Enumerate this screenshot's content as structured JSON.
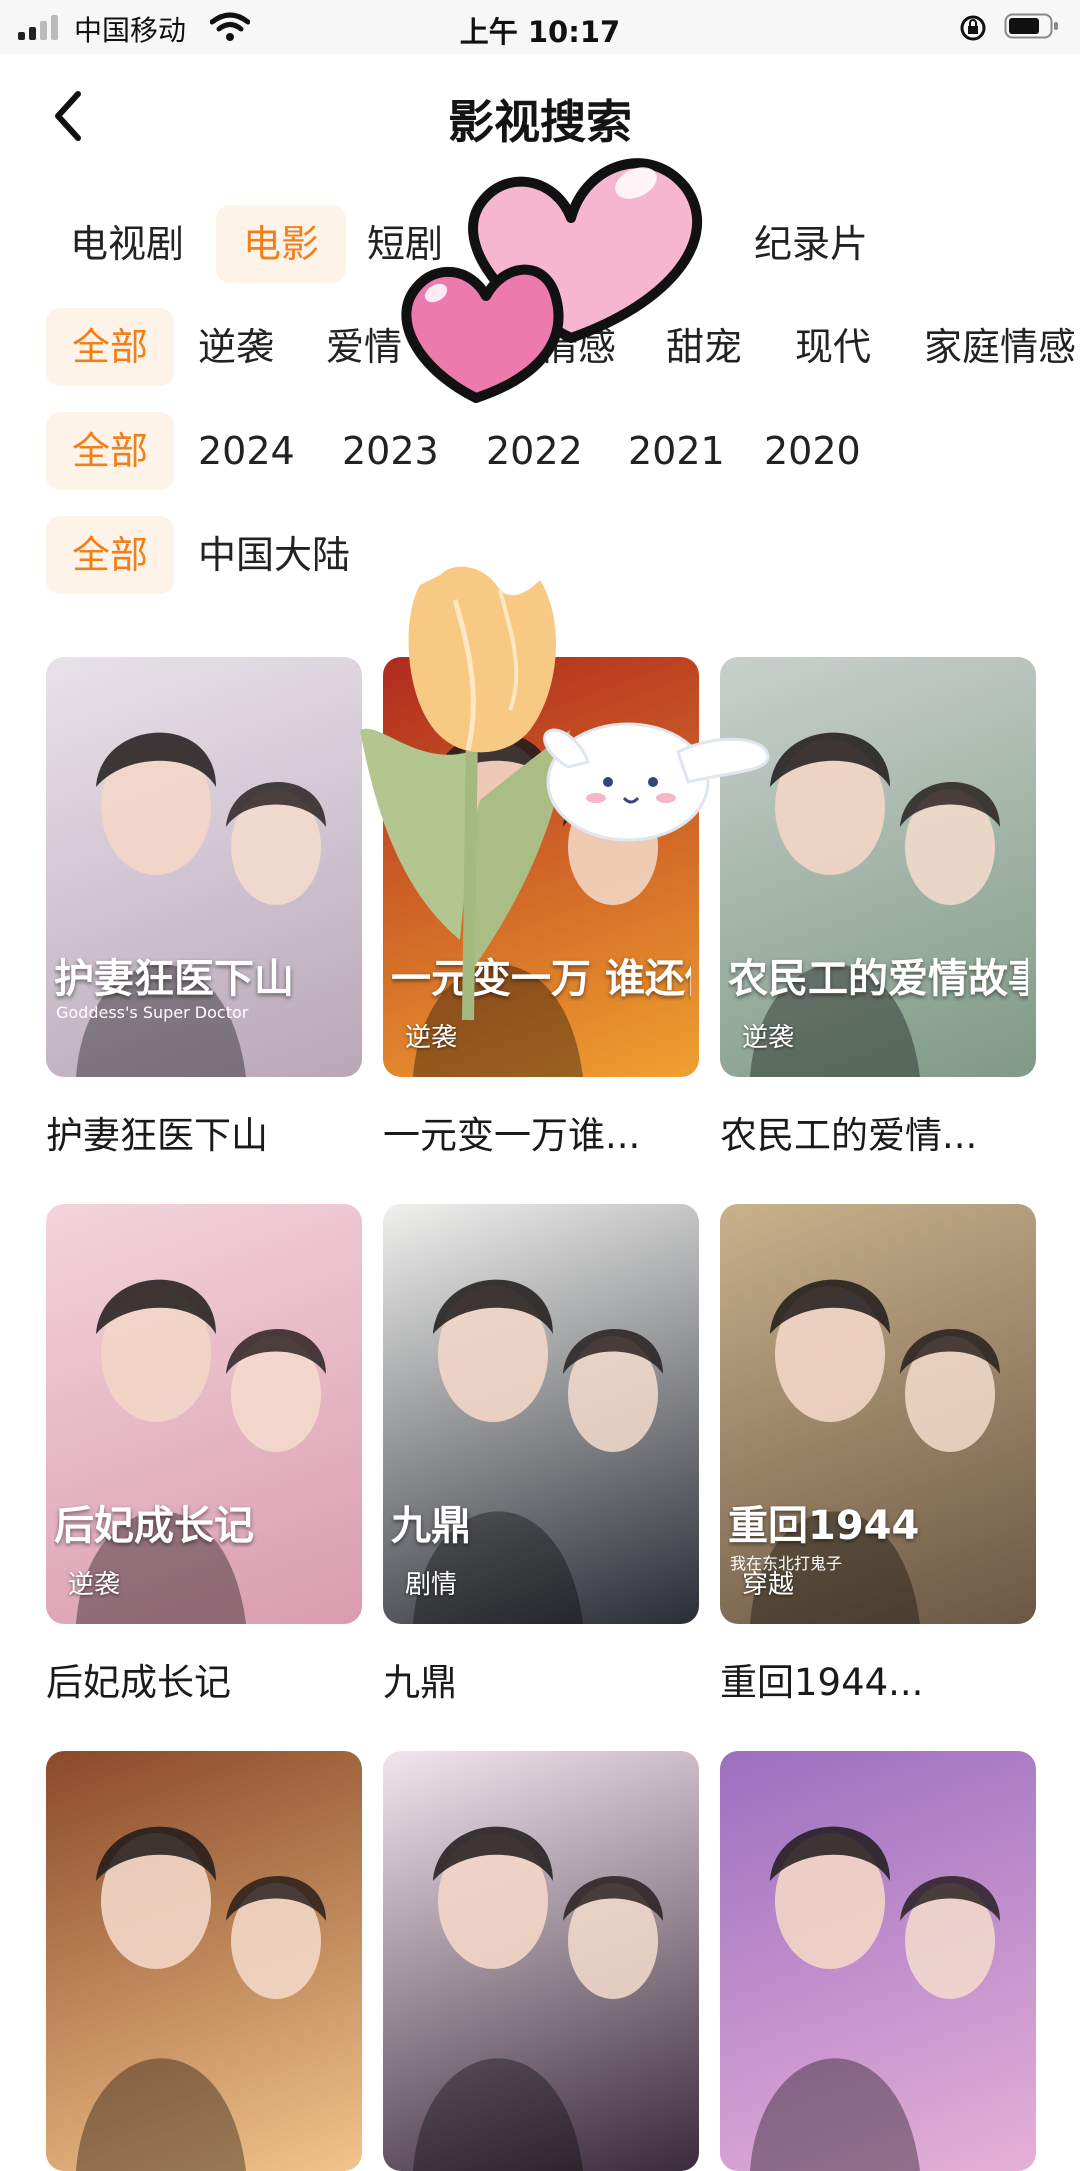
{
  "status_bar": {
    "carrier": "中国移动",
    "time": "上午 10:17"
  },
  "header": {
    "title": "影视搜索"
  },
  "filters": {
    "type": {
      "items": [
        "电视剧",
        "电影",
        "短剧",
        "",
        "纪录片"
      ],
      "selected": "电影"
    },
    "genre": {
      "all_label": "全部",
      "items": [
        "逆袭",
        "爱情",
        "情感",
        "甜宠",
        "现代",
        "家庭情感"
      ]
    },
    "year": {
      "all_label": "全部",
      "items": [
        "2024",
        "2023",
        "2022",
        "2021",
        "2020"
      ]
    },
    "region": {
      "all_label": "全部",
      "items": [
        "中国大陆"
      ]
    }
  },
  "results": [
    {
      "title": "护妻狂医下山",
      "tag": "",
      "poster_text": "护妻狂医下山",
      "poster_subtext": "Goddess's Super Doctor",
      "colors": [
        "#e8e2ea",
        "#b9a7b7"
      ]
    },
    {
      "title": "一元变一万谁...",
      "tag": "逆袭",
      "poster_text": "一元变一万 谁还做舔狗",
      "colors": [
        "#b02a1e",
        "#f0a030"
      ]
    },
    {
      "title": "农民工的爱情...",
      "tag": "逆袭",
      "poster_text": "农民工的爱情故事",
      "colors": [
        "#c9d0cc",
        "#7f9a86"
      ]
    },
    {
      "title": "后妃成长记",
      "tag": "逆袭",
      "poster_text": "后妃成长记",
      "colors": [
        "#f3d3dc",
        "#d99cae"
      ]
    },
    {
      "title": "九鼎",
      "tag": "剧情",
      "poster_text": "九鼎",
      "colors": [
        "#f0f0ee",
        "#2a2d35"
      ]
    },
    {
      "title": "重回1944...",
      "tag": "穿越",
      "poster_text": "重回1944",
      "poster_subtext": "我在东北打鬼子",
      "colors": [
        "#c9b18c",
        "#6b5744"
      ]
    },
    {
      "title": "",
      "tag": "",
      "poster_text": "",
      "colors": [
        "#8a4a2a",
        "#f2c48a"
      ]
    },
    {
      "title": "",
      "tag": "",
      "poster_text": "",
      "colors": [
        "#f2e6ee",
        "#3b2a3a"
      ]
    },
    {
      "title": "",
      "tag": "",
      "poster_text": "",
      "colors": [
        "#9b6fc0",
        "#e6b0d8"
      ]
    }
  ],
  "theme": {
    "accent": "#f0801c",
    "chip_bg": "#fdf3e8"
  }
}
